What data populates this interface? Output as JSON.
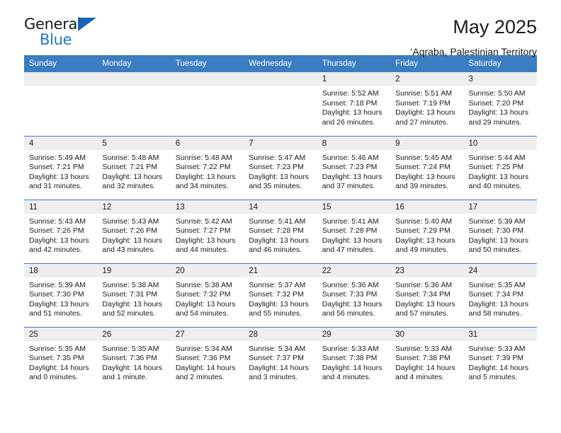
{
  "brand": {
    "line1": "General",
    "line2": "Blue",
    "triangle_color": "#1565b0",
    "blue_text_color": "#1f7ac4"
  },
  "header": {
    "title": "May 2025",
    "subtitle": "‘Aqraba, Palestinian Territory"
  },
  "theme": {
    "header_blue": "#3b7dc0",
    "daynum_gray": "#eeeeee",
    "text": "#1a1a1a"
  },
  "weekday_headers": [
    "Sunday",
    "Monday",
    "Tuesday",
    "Wednesday",
    "Thursday",
    "Friday",
    "Saturday"
  ],
  "labels": {
    "sunrise_prefix": "Sunrise: ",
    "sunset_prefix": "Sunset: ",
    "daylight_prefix": "Daylight: "
  },
  "weeks": [
    [
      {
        "day": "",
        "sunrise": "",
        "sunset": "",
        "daylight_line1": "",
        "daylight_line2": "",
        "empty": true
      },
      {
        "day": "",
        "sunrise": "",
        "sunset": "",
        "daylight_line1": "",
        "daylight_line2": "",
        "empty": true
      },
      {
        "day": "",
        "sunrise": "",
        "sunset": "",
        "daylight_line1": "",
        "daylight_line2": "",
        "empty": true
      },
      {
        "day": "",
        "sunrise": "",
        "sunset": "",
        "daylight_line1": "",
        "daylight_line2": "",
        "empty": true
      },
      {
        "day": "1",
        "sunrise": "Sunrise: 5:52 AM",
        "sunset": "Sunset: 7:18 PM",
        "daylight_line1": "Daylight: 13 hours",
        "daylight_line2": "and 26 minutes.",
        "empty": false
      },
      {
        "day": "2",
        "sunrise": "Sunrise: 5:51 AM",
        "sunset": "Sunset: 7:19 PM",
        "daylight_line1": "Daylight: 13 hours",
        "daylight_line2": "and 27 minutes.",
        "empty": false
      },
      {
        "day": "3",
        "sunrise": "Sunrise: 5:50 AM",
        "sunset": "Sunset: 7:20 PM",
        "daylight_line1": "Daylight: 13 hours",
        "daylight_line2": "and 29 minutes.",
        "empty": false
      }
    ],
    [
      {
        "day": "4",
        "sunrise": "Sunrise: 5:49 AM",
        "sunset": "Sunset: 7:21 PM",
        "daylight_line1": "Daylight: 13 hours",
        "daylight_line2": "and 31 minutes.",
        "empty": false
      },
      {
        "day": "5",
        "sunrise": "Sunrise: 5:48 AM",
        "sunset": "Sunset: 7:21 PM",
        "daylight_line1": "Daylight: 13 hours",
        "daylight_line2": "and 32 minutes.",
        "empty": false
      },
      {
        "day": "6",
        "sunrise": "Sunrise: 5:48 AM",
        "sunset": "Sunset: 7:22 PM",
        "daylight_line1": "Daylight: 13 hours",
        "daylight_line2": "and 34 minutes.",
        "empty": false
      },
      {
        "day": "7",
        "sunrise": "Sunrise: 5:47 AM",
        "sunset": "Sunset: 7:23 PM",
        "daylight_line1": "Daylight: 13 hours",
        "daylight_line2": "and 35 minutes.",
        "empty": false
      },
      {
        "day": "8",
        "sunrise": "Sunrise: 5:46 AM",
        "sunset": "Sunset: 7:23 PM",
        "daylight_line1": "Daylight: 13 hours",
        "daylight_line2": "and 37 minutes.",
        "empty": false
      },
      {
        "day": "9",
        "sunrise": "Sunrise: 5:45 AM",
        "sunset": "Sunset: 7:24 PM",
        "daylight_line1": "Daylight: 13 hours",
        "daylight_line2": "and 39 minutes.",
        "empty": false
      },
      {
        "day": "10",
        "sunrise": "Sunrise: 5:44 AM",
        "sunset": "Sunset: 7:25 PM",
        "daylight_line1": "Daylight: 13 hours",
        "daylight_line2": "and 40 minutes.",
        "empty": false
      }
    ],
    [
      {
        "day": "11",
        "sunrise": "Sunrise: 5:43 AM",
        "sunset": "Sunset: 7:26 PM",
        "daylight_line1": "Daylight: 13 hours",
        "daylight_line2": "and 42 minutes.",
        "empty": false
      },
      {
        "day": "12",
        "sunrise": "Sunrise: 5:43 AM",
        "sunset": "Sunset: 7:26 PM",
        "daylight_line1": "Daylight: 13 hours",
        "daylight_line2": "and 43 minutes.",
        "empty": false
      },
      {
        "day": "13",
        "sunrise": "Sunrise: 5:42 AM",
        "sunset": "Sunset: 7:27 PM",
        "daylight_line1": "Daylight: 13 hours",
        "daylight_line2": "and 44 minutes.",
        "empty": false
      },
      {
        "day": "14",
        "sunrise": "Sunrise: 5:41 AM",
        "sunset": "Sunset: 7:28 PM",
        "daylight_line1": "Daylight: 13 hours",
        "daylight_line2": "and 46 minutes.",
        "empty": false
      },
      {
        "day": "15",
        "sunrise": "Sunrise: 5:41 AM",
        "sunset": "Sunset: 7:28 PM",
        "daylight_line1": "Daylight: 13 hours",
        "daylight_line2": "and 47 minutes.",
        "empty": false
      },
      {
        "day": "16",
        "sunrise": "Sunrise: 5:40 AM",
        "sunset": "Sunset: 7:29 PM",
        "daylight_line1": "Daylight: 13 hours",
        "daylight_line2": "and 49 minutes.",
        "empty": false
      },
      {
        "day": "17",
        "sunrise": "Sunrise: 5:39 AM",
        "sunset": "Sunset: 7:30 PM",
        "daylight_line1": "Daylight: 13 hours",
        "daylight_line2": "and 50 minutes.",
        "empty": false
      }
    ],
    [
      {
        "day": "18",
        "sunrise": "Sunrise: 5:39 AM",
        "sunset": "Sunset: 7:30 PM",
        "daylight_line1": "Daylight: 13 hours",
        "daylight_line2": "and 51 minutes.",
        "empty": false
      },
      {
        "day": "19",
        "sunrise": "Sunrise: 5:38 AM",
        "sunset": "Sunset: 7:31 PM",
        "daylight_line1": "Daylight: 13 hours",
        "daylight_line2": "and 52 minutes.",
        "empty": false
      },
      {
        "day": "20",
        "sunrise": "Sunrise: 5:38 AM",
        "sunset": "Sunset: 7:32 PM",
        "daylight_line1": "Daylight: 13 hours",
        "daylight_line2": "and 54 minutes.",
        "empty": false
      },
      {
        "day": "21",
        "sunrise": "Sunrise: 5:37 AM",
        "sunset": "Sunset: 7:32 PM",
        "daylight_line1": "Daylight: 13 hours",
        "daylight_line2": "and 55 minutes.",
        "empty": false
      },
      {
        "day": "22",
        "sunrise": "Sunrise: 5:36 AM",
        "sunset": "Sunset: 7:33 PM",
        "daylight_line1": "Daylight: 13 hours",
        "daylight_line2": "and 56 minutes.",
        "empty": false
      },
      {
        "day": "23",
        "sunrise": "Sunrise: 5:36 AM",
        "sunset": "Sunset: 7:34 PM",
        "daylight_line1": "Daylight: 13 hours",
        "daylight_line2": "and 57 minutes.",
        "empty": false
      },
      {
        "day": "24",
        "sunrise": "Sunrise: 5:35 AM",
        "sunset": "Sunset: 7:34 PM",
        "daylight_line1": "Daylight: 13 hours",
        "daylight_line2": "and 58 minutes.",
        "empty": false
      }
    ],
    [
      {
        "day": "25",
        "sunrise": "Sunrise: 5:35 AM",
        "sunset": "Sunset: 7:35 PM",
        "daylight_line1": "Daylight: 14 hours",
        "daylight_line2": "and 0 minutes.",
        "empty": false
      },
      {
        "day": "26",
        "sunrise": "Sunrise: 5:35 AM",
        "sunset": "Sunset: 7:36 PM",
        "daylight_line1": "Daylight: 14 hours",
        "daylight_line2": "and 1 minute.",
        "empty": false
      },
      {
        "day": "27",
        "sunrise": "Sunrise: 5:34 AM",
        "sunset": "Sunset: 7:36 PM",
        "daylight_line1": "Daylight: 14 hours",
        "daylight_line2": "and 2 minutes.",
        "empty": false
      },
      {
        "day": "28",
        "sunrise": "Sunrise: 5:34 AM",
        "sunset": "Sunset: 7:37 PM",
        "daylight_line1": "Daylight: 14 hours",
        "daylight_line2": "and 3 minutes.",
        "empty": false
      },
      {
        "day": "29",
        "sunrise": "Sunrise: 5:33 AM",
        "sunset": "Sunset: 7:38 PM",
        "daylight_line1": "Daylight: 14 hours",
        "daylight_line2": "and 4 minutes.",
        "empty": false
      },
      {
        "day": "30",
        "sunrise": "Sunrise: 5:33 AM",
        "sunset": "Sunset: 7:38 PM",
        "daylight_line1": "Daylight: 14 hours",
        "daylight_line2": "and 4 minutes.",
        "empty": false
      },
      {
        "day": "31",
        "sunrise": "Sunrise: 5:33 AM",
        "sunset": "Sunset: 7:39 PM",
        "daylight_line1": "Daylight: 14 hours",
        "daylight_line2": "and 5 minutes.",
        "empty": false
      }
    ]
  ]
}
